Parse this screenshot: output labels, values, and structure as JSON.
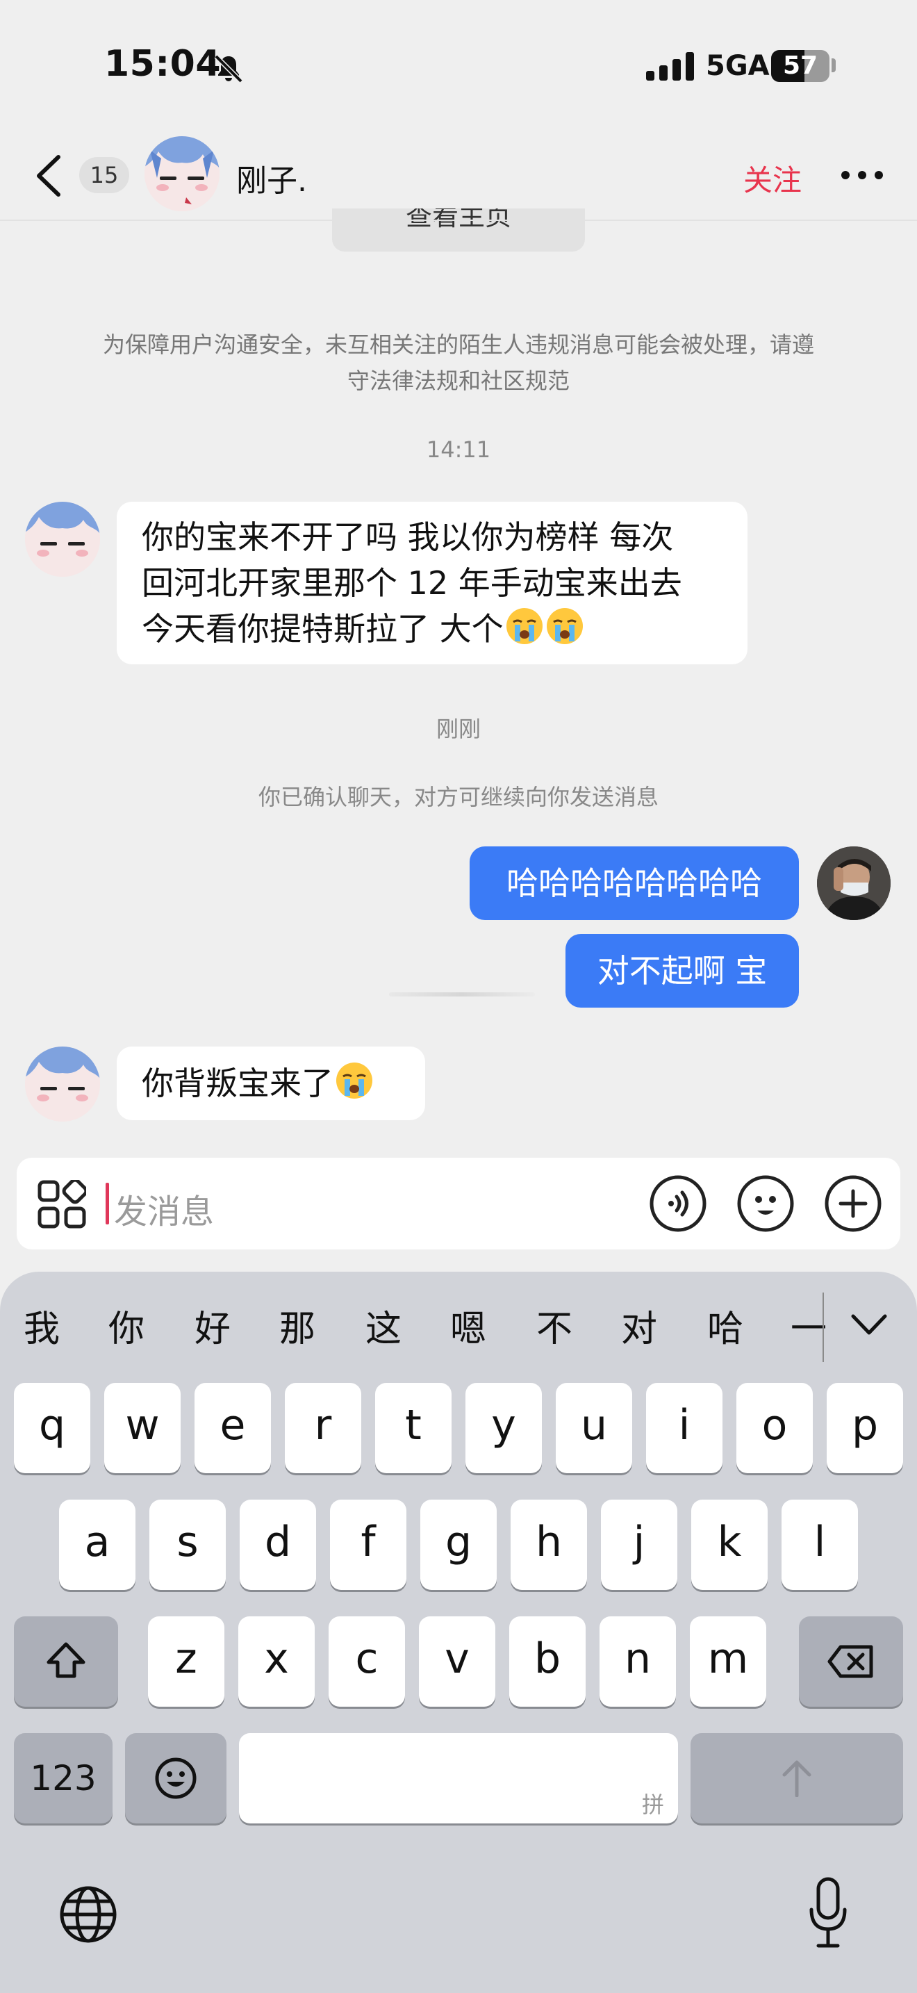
{
  "status_bar": {
    "time": "15:04",
    "network": "5GA",
    "battery": "57",
    "battery_level": 0.57
  },
  "header": {
    "unread_count": "15",
    "contact_name": "刚子.",
    "follow_label": "关注"
  },
  "partial_button_label": "查看主页",
  "notice": "为保障用户沟通安全，未互相关注的陌生人违规消息可能会被处理，请遵守法律法规和社区规范",
  "timestamps": {
    "first": "14:11",
    "second": "刚刚"
  },
  "system_message": "你已确认聊天，对方可继续向你发送消息",
  "messages": [
    {
      "sender": "other",
      "lines": [
        "你的宝来不开了吗 我以你为榜样 每次",
        "回河北开家里那个 12 年手动宝来出去",
        "今天看你提特斯拉了 大个"
      ],
      "emoji_count": 2,
      "emoji": "loudly-crying-emoji"
    },
    {
      "sender": "me",
      "text": "哈哈哈哈哈哈哈哈"
    },
    {
      "sender": "me",
      "text": "对不起啊 宝"
    },
    {
      "sender": "other",
      "text": "你背叛宝来了",
      "emoji_count": 1,
      "emoji": "loudly-crying-emoji"
    }
  ],
  "input": {
    "placeholder": "发消息"
  },
  "keyboard": {
    "candidates": [
      "我",
      "你",
      "好",
      "那",
      "这",
      "嗯",
      "不",
      "对",
      "哈",
      "一"
    ],
    "row1": [
      "q",
      "w",
      "e",
      "r",
      "t",
      "y",
      "u",
      "i",
      "o",
      "p"
    ],
    "row2": [
      "a",
      "s",
      "d",
      "f",
      "g",
      "h",
      "j",
      "k",
      "l"
    ],
    "row3": [
      "z",
      "x",
      "c",
      "v",
      "b",
      "n",
      "m"
    ],
    "numbers_label": "123",
    "space_hint": "拼"
  },
  "colors": {
    "accent_red": "#e8344d",
    "my_bubble": "#3b7bf6"
  }
}
